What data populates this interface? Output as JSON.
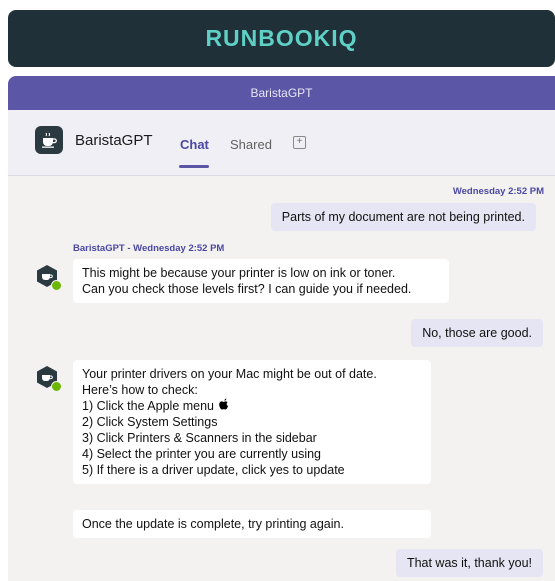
{
  "brand": {
    "title": "RUNBOOKIQ"
  },
  "window": {
    "title": "BaristaGPT"
  },
  "header": {
    "bot_name": "BaristaGPT",
    "tabs": [
      {
        "label": "Chat",
        "active": true
      },
      {
        "label": "Shared",
        "active": false
      }
    ],
    "add_tab_icon": "plus-box-icon"
  },
  "conversation": {
    "user_msg_1": {
      "timestamp": "Wednesday 2:52 PM",
      "text": "Parts of my document are not being printed."
    },
    "bot_msg_1": {
      "sender_line": "BaristaGPT - Wednesday 2:52 PM",
      "lines": [
        "This might be because your printer is low on ink or toner.",
        "Can you check those levels first? I can guide you if needed."
      ]
    },
    "user_msg_2": {
      "text": "No, those are good."
    },
    "bot_msg_2": {
      "lines": [
        "Your printer drivers on your Mac might be out of date.",
        "Here’s how to check:",
        "1) Click the Apple menu",
        "2) Click System Settings",
        "3) Click Printers & Scanners in the sidebar",
        "4) Select the printer you are currently using",
        "5) If there is a driver update, click yes to update"
      ],
      "apple_icon": "apple-logo-icon"
    },
    "bot_msg_3": {
      "text": "Once the update is complete, try printing again."
    },
    "user_msg_3": {
      "text": "That was it, thank you!"
    }
  },
  "colors": {
    "brand_bg": "#1f3038",
    "brand_text": "#5fd0c6",
    "titlebar": "#5b56a6",
    "accent": "#4b48a3",
    "user_bubble": "#e5e5f3",
    "presence": "#6bb700"
  }
}
